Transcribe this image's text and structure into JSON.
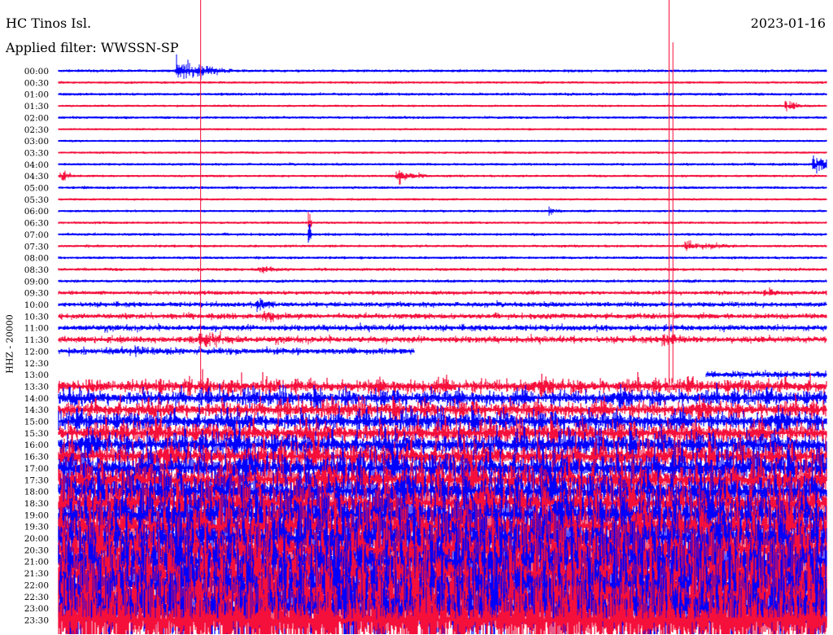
{
  "header": {
    "station": "HC Tinos Isl.",
    "date": "2023-01-16",
    "filter": "Applied filter: WWSSN-SP",
    "channel_label": "HHZ - 20000"
  },
  "chart_data": {
    "type": "line",
    "subtype": "helicorder",
    "title": "HC Tinos Isl.",
    "ylabel": "HHZ - 20000",
    "minutes_per_row": 30,
    "colors": {
      "even_rows": "#0000ff",
      "odd_rows": "#f5103c",
      "marker": "#f5103c"
    },
    "rows": [
      {
        "label": "00:00",
        "level": 0.08
      },
      {
        "label": "00:30",
        "level": 0.06
      },
      {
        "label": "01:00",
        "level": 0.08
      },
      {
        "label": "01:30",
        "level": 0.05
      },
      {
        "label": "02:00",
        "level": 0.07
      },
      {
        "label": "02:30",
        "level": 0.04
      },
      {
        "label": "03:00",
        "level": 0.05
      },
      {
        "label": "03:30",
        "level": 0.05
      },
      {
        "label": "04:00",
        "level": 0.07
      },
      {
        "label": "04:30",
        "level": 0.06
      },
      {
        "label": "05:00",
        "level": 0.07
      },
      {
        "label": "05:30",
        "level": 0.05
      },
      {
        "label": "06:00",
        "level": 0.06
      },
      {
        "label": "06:30",
        "level": 0.06
      },
      {
        "label": "07:00",
        "level": 0.08
      },
      {
        "label": "07:30",
        "level": 0.07
      },
      {
        "label": "08:00",
        "level": 0.07
      },
      {
        "label": "08:30",
        "level": 0.09
      },
      {
        "label": "09:00",
        "level": 0.09
      },
      {
        "label": "09:30",
        "level": 0.14
      },
      {
        "label": "10:00",
        "level": 0.2
      },
      {
        "label": "10:30",
        "level": 0.22
      },
      {
        "label": "11:00",
        "level": 0.25
      },
      {
        "label": "11:30",
        "level": 0.28
      },
      {
        "label": "12:00",
        "level": 0.28,
        "end_min": 13.9
      },
      {
        "label": "12:30",
        "level": 0,
        "end_min": 0
      },
      {
        "label": "13:00",
        "level": 0.3,
        "start_min": 25.3
      },
      {
        "label": "13:30",
        "level": 0.55
      },
      {
        "label": "14:00",
        "level": 0.6
      },
      {
        "label": "14:30",
        "level": 0.65
      },
      {
        "label": "15:00",
        "level": 0.75
      },
      {
        "label": "15:30",
        "level": 0.85
      },
      {
        "label": "16:00",
        "level": 0.95
      },
      {
        "label": "16:30",
        "level": 1.05
      },
      {
        "label": "17:00",
        "level": 1.3
      },
      {
        "label": "17:30",
        "level": 1.4
      },
      {
        "label": "18:00",
        "level": 1.6
      },
      {
        "label": "18:30",
        "level": 1.7
      },
      {
        "label": "19:00",
        "level": 1.9
      },
      {
        "label": "19:30",
        "level": 2.0
      },
      {
        "label": "20:00",
        "level": 2.2
      },
      {
        "label": "20:30",
        "level": 2.3
      },
      {
        "label": "21:00",
        "level": 2.5
      },
      {
        "label": "21:30",
        "level": 2.6
      },
      {
        "label": "22:00",
        "level": 2.8
      },
      {
        "label": "22:30",
        "level": 3.0
      },
      {
        "label": "23:00",
        "level": 3.2
      },
      {
        "label": "23:30",
        "level": 3.4
      }
    ],
    "events": [
      {
        "row": "00:00",
        "minute": 4.6,
        "duration": 2.2,
        "amp": 1.0
      },
      {
        "row": "01:30",
        "minute": 28.4,
        "duration": 0.8,
        "amp": 0.5
      },
      {
        "row": "04:00",
        "minute": 29.5,
        "duration": 0.6,
        "amp": 1.3
      },
      {
        "row": "04:30",
        "minute": 0.1,
        "duration": 0.6,
        "amp": 0.5
      },
      {
        "row": "04:30",
        "minute": 13.2,
        "duration": 1.2,
        "amp": 0.7
      },
      {
        "row": "06:00",
        "minute": 19.2,
        "duration": 0.6,
        "amp": 0.3
      },
      {
        "row": "06:30",
        "minute": 9.8,
        "duration": 0.1,
        "amp": 1.0
      },
      {
        "row": "07:00",
        "minute": 9.8,
        "duration": 0.1,
        "amp": 1.3
      },
      {
        "row": "07:30",
        "minute": 24.5,
        "duration": 2.5,
        "amp": 0.4
      },
      {
        "row": "08:30",
        "minute": 7.8,
        "duration": 1.5,
        "amp": 0.35
      },
      {
        "row": "09:30",
        "minute": 27.6,
        "duration": 1.0,
        "amp": 0.5
      },
      {
        "row": "10:00",
        "minute": 7.8,
        "duration": 1.0,
        "amp": 0.7
      },
      {
        "row": "10:30",
        "minute": 8.0,
        "duration": 2.0,
        "amp": 0.5
      },
      {
        "row": "11:30",
        "minute": 5.5,
        "duration": 2.2,
        "amp": 0.9
      },
      {
        "row": "11:30",
        "minute": 23.6,
        "duration": 1.5,
        "amp": 0.8
      },
      {
        "row": "12:00",
        "minute": 3.0,
        "duration": 2.5,
        "amp": 0.5
      }
    ],
    "markers": [
      {
        "minute": 5.55,
        "from_row": "00:00",
        "to_row": "13:00"
      },
      {
        "minute": 23.85,
        "from_row": "00:00",
        "to_row": "13:00"
      },
      {
        "minute": 24.0,
        "from_row": "00:00",
        "to_row": "13:00"
      }
    ]
  }
}
